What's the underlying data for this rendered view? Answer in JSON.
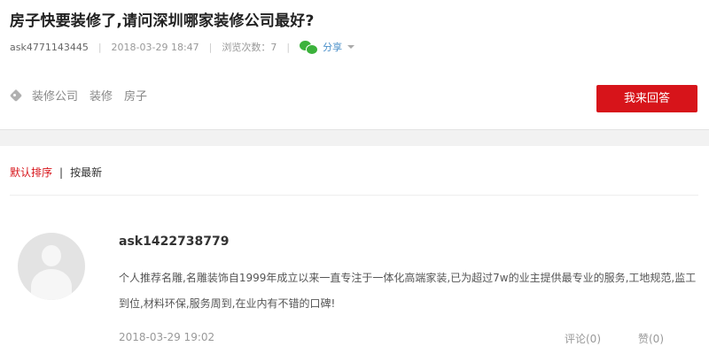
{
  "question": {
    "title": "房子快要装修了,请问深圳哪家装修公司最好?",
    "author": "ask4771143445",
    "time": "2018-03-29 18:47",
    "views": "浏览次数：7",
    "share_label": "分享",
    "tags": [
      "装修公司",
      "装修",
      "房子"
    ],
    "answer_button": "我来回答"
  },
  "sort": {
    "default_label": "默认排序",
    "separator": "|",
    "latest_label": "按最新"
  },
  "answer": {
    "username": "ask1422738779",
    "content": "个人推荐名雕,名雕装饰自1999年成立以来一直专注于一体化高端家装,已为超过7w的业主提供最专业的服务,工地规范,监工到位,材料环保,服务周到,在业内有不错的口碑!",
    "time": "2018-03-29 19:02",
    "comment_label": "评论(0)",
    "like_label": "赞(0)"
  },
  "icons": {
    "tag": "tag-icon",
    "share": "wechat-icon",
    "avatar": "default-avatar"
  },
  "colors": {
    "accent": "#d7141a",
    "share_link": "#4a8fc9",
    "wechat": "#3bb23b"
  }
}
